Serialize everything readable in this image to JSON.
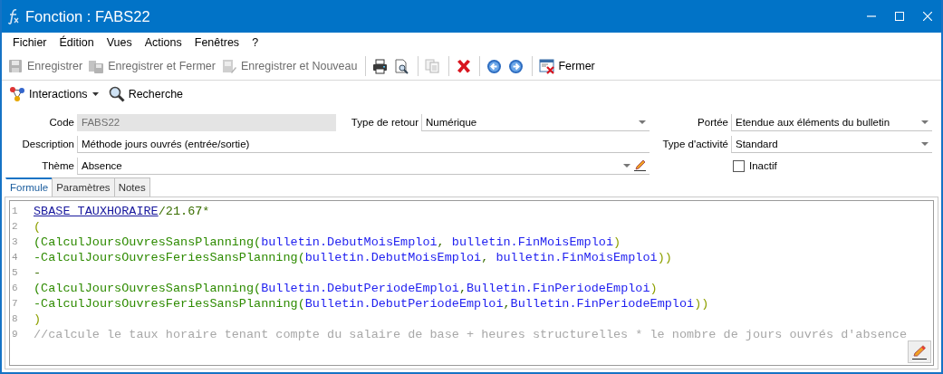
{
  "window": {
    "title": "Fonction : FABS22"
  },
  "menu": [
    "Fichier",
    "Édition",
    "Vues",
    "Actions",
    "Fenêtres",
    "?"
  ],
  "toolbar": [
    {
      "kind": "button",
      "label": "Enregistrer",
      "disabled": true
    },
    {
      "kind": "button",
      "label": "Enregistrer et Fermer",
      "disabled": true
    },
    {
      "kind": "button",
      "label": "Enregistrer et Nouveau",
      "disabled": true
    },
    {
      "kind": "separator"
    },
    {
      "kind": "button",
      "disabled": false
    },
    {
      "kind": "button",
      "disabled": false
    },
    {
      "kind": "separator"
    },
    {
      "kind": "button",
      "disabled": true
    },
    {
      "kind": "separator"
    },
    {
      "kind": "button",
      "disabled": false
    },
    {
      "kind": "separator"
    },
    {
      "kind": "button",
      "disabled": false
    },
    {
      "kind": "button",
      "disabled": false
    },
    {
      "kind": "separator"
    },
    {
      "kind": "button",
      "label": "Fermer",
      "disabled": false
    }
  ],
  "toolbar2": [
    {
      "label": "Interactions",
      "dropdown": true
    },
    {
      "label": "Recherche",
      "dropdown": false
    }
  ],
  "form": {
    "code": {
      "label": "Code",
      "value": "FABS22",
      "disabled": true
    },
    "return_type": {
      "label": "Type de retour",
      "value": "Numérique"
    },
    "scope": {
      "label": "Portée",
      "value": "Etendue aux éléments du bulletin"
    },
    "description": {
      "label": "Description",
      "value": "Méthode jours ouvrés (entrée/sortie)"
    },
    "activity_type": {
      "label": "Type d'activité",
      "value": "Standard"
    },
    "theme": {
      "label": "Thème",
      "value": "Absence"
    },
    "inactive": {
      "label": "Inactif",
      "checked": false
    }
  },
  "tabs": [
    {
      "label": "Formule",
      "selected": true
    },
    {
      "label": "Paramètres",
      "selected": false
    },
    {
      "label": "Notes",
      "selected": false
    }
  ],
  "editor": {
    "lines": [
      {
        "number": "1",
        "tokens": [
          {
            "kind": "variable",
            "text": "SBASE_TAUXHORAIRE"
          },
          {
            "kind": "operator",
            "text": "/21.67*"
          }
        ]
      },
      {
        "number": "2",
        "tokens": [
          {
            "kind": "paren",
            "text": "("
          }
        ]
      },
      {
        "number": "3",
        "tokens": [
          {
            "kind": "function",
            "text": "(CalculJoursOuvresSansPlanning("
          },
          {
            "kind": "field",
            "text": "bulletin.DebutMoisEmploi"
          },
          {
            "kind": "operator",
            "text": ", "
          },
          {
            "kind": "field",
            "text": "bulletin.FinMoisEmploi"
          },
          {
            "kind": "paren",
            "text": ")"
          }
        ]
      },
      {
        "number": "4",
        "tokens": [
          {
            "kind": "function",
            "text": "-CalculJoursOuvresFeriesSansPlanning("
          },
          {
            "kind": "field",
            "text": "bulletin.DebutMoisEmploi"
          },
          {
            "kind": "operator",
            "text": ", "
          },
          {
            "kind": "field",
            "text": "bulletin.FinMoisEmploi"
          },
          {
            "kind": "paren",
            "text": "))"
          }
        ]
      },
      {
        "number": "5",
        "tokens": [
          {
            "kind": "operator",
            "text": "-"
          }
        ]
      },
      {
        "number": "6",
        "tokens": [
          {
            "kind": "function",
            "text": "(CalculJoursOuvresSansPlanning("
          },
          {
            "kind": "field",
            "text": "Bulletin.DebutPeriodeEmploi"
          },
          {
            "kind": "operator",
            "text": ","
          },
          {
            "kind": "field",
            "text": "Bulletin.FinPeriodeEmploi"
          },
          {
            "kind": "paren",
            "text": ")"
          }
        ]
      },
      {
        "number": "7",
        "tokens": [
          {
            "kind": "function",
            "text": "-CalculJoursOuvresFeriesSansPlanning("
          },
          {
            "kind": "field",
            "text": "Bulletin.DebutPeriodeEmploi"
          },
          {
            "kind": "operator",
            "text": ","
          },
          {
            "kind": "field",
            "text": "Bulletin.FinPeriodeEmploi"
          },
          {
            "kind": "paren",
            "text": "))"
          }
        ]
      },
      {
        "number": "8",
        "tokens": [
          {
            "kind": "paren",
            "text": ")"
          }
        ]
      },
      {
        "number": "9",
        "tokens": [
          {
            "kind": "comment",
            "text": "//calcule le taux horaire tenant compte du salaire de base + heures structurelles * le nombre de jours ouvrés d'absence"
          }
        ]
      }
    ]
  }
}
